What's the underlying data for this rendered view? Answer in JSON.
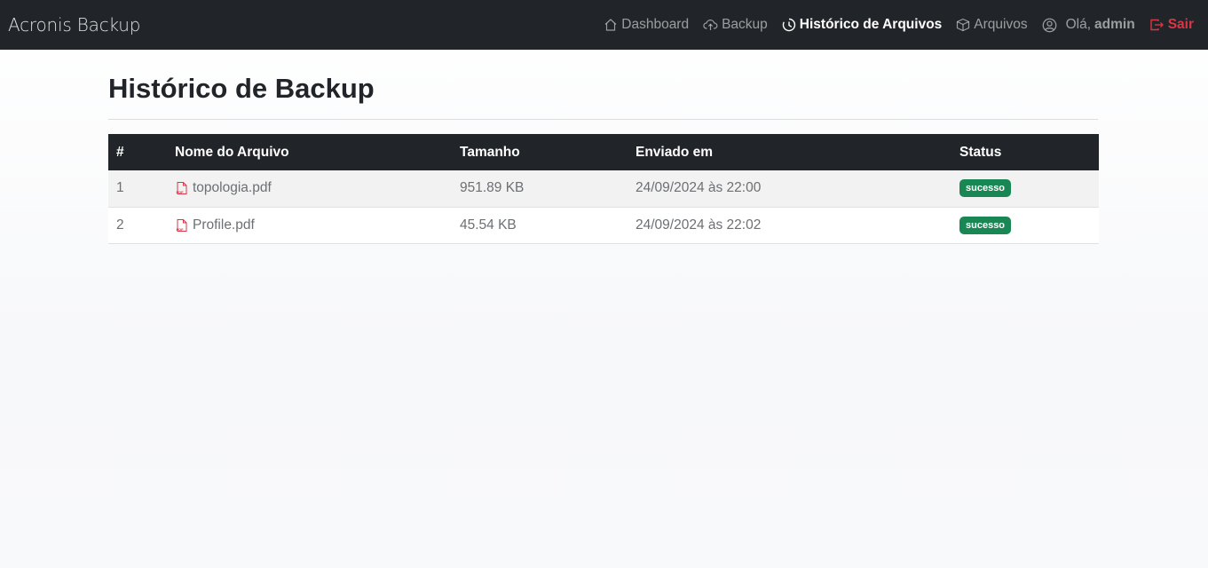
{
  "navbar": {
    "brand": "Acronis Backup",
    "items": [
      {
        "label": "Dashboard",
        "icon": "house-icon"
      },
      {
        "label": "Backup",
        "icon": "cloud-upload-icon"
      },
      {
        "label": "Histórico de Arquivos",
        "icon": "clock-history-icon",
        "active": true
      },
      {
        "label": "Arquivos",
        "icon": "box-icon"
      }
    ],
    "user": {
      "greeting": "Olá,",
      "name": "admin",
      "icon": "person-circle-icon"
    },
    "logout": {
      "label": "Sair",
      "icon": "box-arrow-right-icon"
    }
  },
  "main": {
    "title": "Histórico de Backup",
    "table": {
      "headers": [
        "#",
        "Nome do Arquivo",
        "Tamanho",
        "Enviado em",
        "Status"
      ],
      "rows": [
        {
          "index": "1",
          "file": "topologia.pdf",
          "size": "951.89 KB",
          "sent_at": "24/09/2024 às 22:00",
          "status": "sucesso"
        },
        {
          "index": "2",
          "file": "Profile.pdf",
          "size": "45.54 KB",
          "sent_at": "24/09/2024 às 22:02",
          "status": "sucesso"
        }
      ]
    }
  },
  "colors": {
    "navbar_bg": "#212529",
    "danger": "#dc3545",
    "success": "#198754"
  }
}
